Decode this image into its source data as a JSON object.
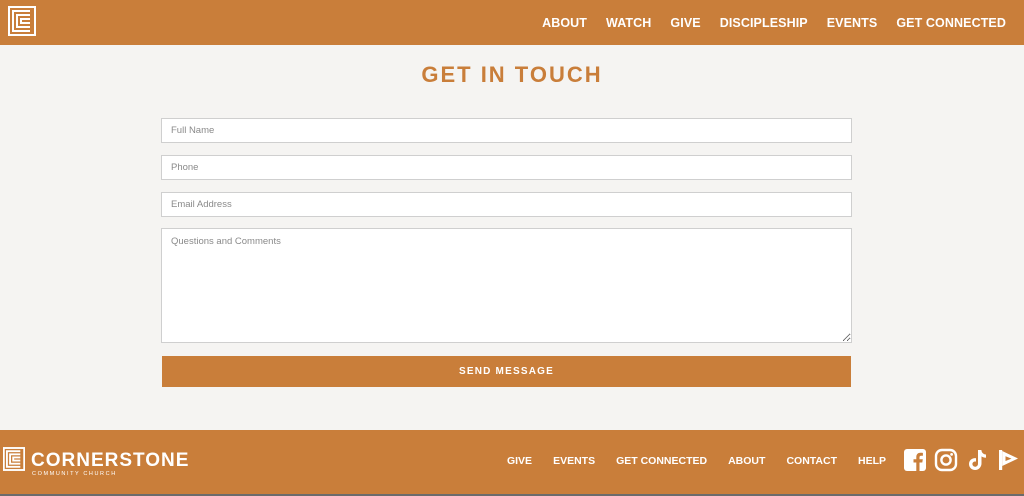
{
  "header": {
    "logo": "cornerstone-square-logo",
    "nav": [
      "ABOUT",
      "WATCH",
      "GIVE",
      "DISCIPLESHIP",
      "EVENTS",
      "GET CONNECTED"
    ]
  },
  "main": {
    "title": "GET IN TOUCH",
    "form": {
      "full_name_placeholder": "Full Name",
      "phone_placeholder": "Phone",
      "email_placeholder": "Email Address",
      "comments_placeholder": "Questions and Comments",
      "submit_label": "SEND MESSAGE"
    }
  },
  "footer": {
    "brand_name": "CORNERSTONE",
    "brand_sub": "COMMUNITY CHURCH",
    "nav": [
      "GIVE",
      "EVENTS",
      "GET CONNECTED",
      "ABOUT",
      "CONTACT",
      "HELP"
    ],
    "social": [
      "facebook-icon",
      "instagram-icon",
      "tiktok-icon",
      "flag-icon"
    ]
  },
  "colors": {
    "brand": "#c97e3a",
    "background": "#f5f4f2",
    "text_on_brand": "#ffffff"
  }
}
